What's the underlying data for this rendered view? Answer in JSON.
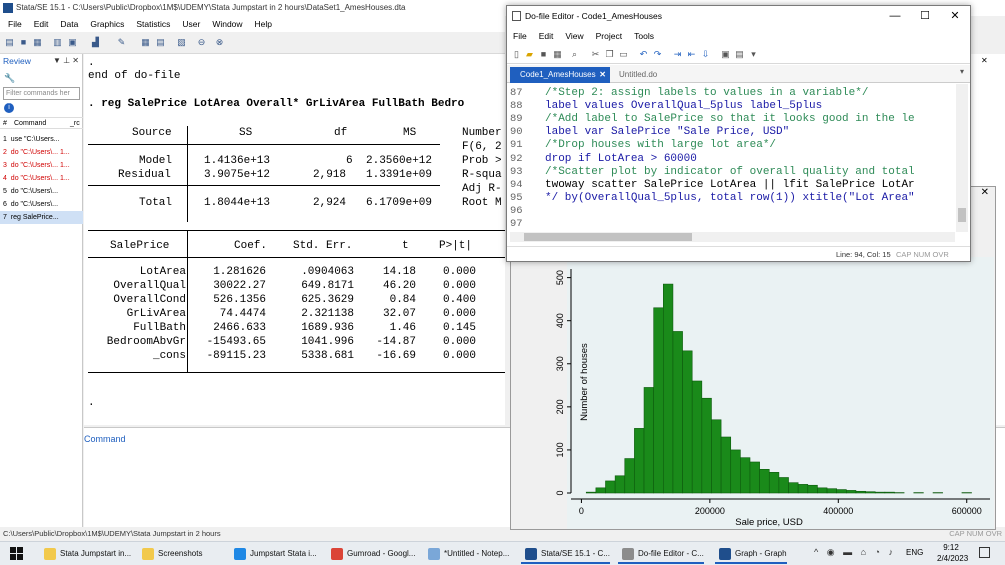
{
  "stata": {
    "title": "Stata/SE 15.1 - C:\\Users\\Public\\Dropbox\\1M$\\UDEMY\\Stata Jumpstart in 2 hours\\DataSet1_AmesHouses.dta",
    "menu": [
      "File",
      "Edit",
      "Data",
      "Graphics",
      "Statistics",
      "User",
      "Window",
      "Help"
    ],
    "review": {
      "label": "Review",
      "filter_placeholder": "Filter commands her",
      "col_num": "#",
      "col_command": "Command",
      "col_rc": "_rc",
      "items": [
        {
          "num": "1",
          "text": "use \"C:\\Users...",
          "error": false
        },
        {
          "num": "2",
          "text": "do \"C:\\Users\\... 1...",
          "error": true
        },
        {
          "num": "3",
          "text": "do \"C:\\Users\\... 1...",
          "error": true
        },
        {
          "num": "4",
          "text": "do \"C:\\Users\\... 1...",
          "error": true
        },
        {
          "num": "5",
          "text": "do \"C:\\Users\\...",
          "error": false
        },
        {
          "num": "6",
          "text": "do \"C:\\Users\\...",
          "error": false
        },
        {
          "num": "7",
          "text": "reg SalePrice...",
          "error": false
        }
      ]
    },
    "results": {
      "dot1": ".",
      "end_line": "end of do-file",
      "cmd": ". reg SalePrice LotArea Overall* GrLivArea FullBath Bedro",
      "anova_header": {
        "source": "Source",
        "ss": "SS",
        "df": "df",
        "ms": "MS"
      },
      "anova_rows": [
        {
          "source": "Model",
          "ss": "1.4136e+13",
          "df": "6",
          "ms": "2.3560e+12"
        },
        {
          "source": "Residual",
          "ss": "3.9075e+12",
          "df": "2,918",
          "ms": "1.3391e+09"
        },
        {
          "source": "Total",
          "ss": "1.8044e+13",
          "df": "2,924",
          "ms": "6.1709e+09"
        }
      ],
      "stats_labels": [
        "Number",
        "F(6, 2",
        "Prob >",
        "R-squa",
        "Adj R-",
        "Root M"
      ],
      "coef_header": {
        "var": "SalePrice",
        "coef": "Coef.",
        "se": "Std. Err.",
        "t": "t",
        "p": "P>|t|"
      },
      "coef_rows": [
        {
          "var": "LotArea",
          "coef": "1.281626",
          "se": ".0904063",
          "t": "14.18",
          "p": "0.000"
        },
        {
          "var": "OverallQual",
          "coef": "30022.27",
          "se": "649.8171",
          "t": "46.20",
          "p": "0.000"
        },
        {
          "var": "OverallCond",
          "coef": "526.1356",
          "se": "625.3629",
          "t": "0.84",
          "p": "0.400"
        },
        {
          "var": "GrLivArea",
          "coef": "74.4474",
          "se": "2.321138",
          "t": "32.07",
          "p": "0.000"
        },
        {
          "var": "FullBath",
          "coef": "2466.633",
          "se": "1689.936",
          "t": "1.46",
          "p": "0.145"
        },
        {
          "var": "BedroomAbvGr",
          "coef": "-15493.65",
          "se": "1041.996",
          "t": "-14.87",
          "p": "0.000"
        },
        {
          "var": "_cons",
          "coef": "-89115.23",
          "se": "5338.681",
          "t": "-16.69",
          "p": "0.000"
        }
      ],
      "dot2": "."
    },
    "command_label": "Command",
    "status_path": "C:\\Users\\Public\\Dropbox\\1M$\\UDEMY\\Stata Jumpstart in 2 hours",
    "status_right": "CAP   NUM   OVR"
  },
  "dofile": {
    "title": "Do-file Editor - Code1_AmesHouses",
    "menu": [
      "File",
      "Edit",
      "View",
      "Project",
      "Tools"
    ],
    "tab_active": "Code1_AmesHouses",
    "tab_inactive": "Untitled.do",
    "lines": [
      {
        "n": "87",
        "cls": "c-cmt",
        "text": "/*Step 2: assign labels to values in a variable*/"
      },
      {
        "n": "88",
        "cls": "c-kw",
        "text": "label values OverallQual_5plus label_5plus"
      },
      {
        "n": "89",
        "cls": "c-cmt",
        "text": "/*Add label to SalePrice so that it looks good in the le"
      },
      {
        "n": "90",
        "cls": "c-kw",
        "text": "label var SalePrice \"Sale Price, USD\""
      },
      {
        "n": "91",
        "cls": "c-cmt",
        "text": "/*Drop houses with large lot area*/"
      },
      {
        "n": "92",
        "cls": "c-kw",
        "text": "drop if LotArea > 60000"
      },
      {
        "n": "93",
        "cls": "c-cmt",
        "text": "/*Scatter plot by indicator of overall quality and total"
      },
      {
        "n": "94",
        "cls": "c-pl",
        "text": "twoway scatter SalePrice LotArea || lfit SalePrice LotAr"
      },
      {
        "n": "95",
        "cls": "c-kw",
        "text": "*/ by(OverallQual_5plus, total row(1)) xtitle(\"Lot Area\""
      },
      {
        "n": "96",
        "cls": "c-pl",
        "text": ""
      },
      {
        "n": "97",
        "cls": "c-pl",
        "text": ""
      }
    ],
    "status": "Line: 94, Col: 15",
    "status_right": "CAP   NUM   OVR"
  },
  "graph": {
    "chart_data": {
      "type": "bar",
      "title": "",
      "xlabel": "Sale price, USD",
      "ylabel": "Number of houses",
      "xlim": [
        -10000,
        630000
      ],
      "ylim": [
        0,
        520
      ],
      "xticks": [
        0,
        200000,
        400000,
        600000
      ],
      "yticks": [
        0,
        100,
        200,
        300,
        400,
        500
      ],
      "bin_width": 15000,
      "bins": [
        {
          "x": 15000,
          "count": 2
        },
        {
          "x": 30000,
          "count": 12
        },
        {
          "x": 45000,
          "count": 28
        },
        {
          "x": 60000,
          "count": 40
        },
        {
          "x": 75000,
          "count": 80
        },
        {
          "x": 90000,
          "count": 150
        },
        {
          "x": 105000,
          "count": 245
        },
        {
          "x": 120000,
          "count": 430
        },
        {
          "x": 135000,
          "count": 485
        },
        {
          "x": 150000,
          "count": 375
        },
        {
          "x": 165000,
          "count": 330
        },
        {
          "x": 180000,
          "count": 260
        },
        {
          "x": 195000,
          "count": 220
        },
        {
          "x": 210000,
          "count": 170
        },
        {
          "x": 225000,
          "count": 130
        },
        {
          "x": 240000,
          "count": 100
        },
        {
          "x": 255000,
          "count": 82
        },
        {
          "x": 270000,
          "count": 72
        },
        {
          "x": 285000,
          "count": 55
        },
        {
          "x": 300000,
          "count": 48
        },
        {
          "x": 315000,
          "count": 36
        },
        {
          "x": 330000,
          "count": 24
        },
        {
          "x": 345000,
          "count": 20
        },
        {
          "x": 360000,
          "count": 18
        },
        {
          "x": 375000,
          "count": 12
        },
        {
          "x": 390000,
          "count": 10
        },
        {
          "x": 405000,
          "count": 8
        },
        {
          "x": 420000,
          "count": 6
        },
        {
          "x": 435000,
          "count": 4
        },
        {
          "x": 450000,
          "count": 3
        },
        {
          "x": 465000,
          "count": 2
        },
        {
          "x": 480000,
          "count": 2
        },
        {
          "x": 495000,
          "count": 1
        },
        {
          "x": 525000,
          "count": 1
        },
        {
          "x": 555000,
          "count": 1
        },
        {
          "x": 600000,
          "count": 1
        }
      ],
      "bar_color": "#1a8a1a"
    }
  },
  "taskbar": {
    "items": [
      {
        "label": "Stata Jumpstart in...",
        "color": "#f2c94c",
        "active": false
      },
      {
        "label": "Screenshots",
        "color": "#f2c94c",
        "active": false
      },
      {
        "label": "Jumpstart Stata i...",
        "color": "#1e88e5",
        "active": false
      },
      {
        "label": "Gumroad - Googl...",
        "color": "#db4437",
        "active": false
      },
      {
        "label": "*Untitled - Notep...",
        "color": "#7aa7d8",
        "active": false
      },
      {
        "label": "Stata/SE 15.1 - C...",
        "color": "#1f4e8c",
        "active": true
      },
      {
        "label": "Do-file Editor - C...",
        "color": "#8c8c8c",
        "active": true
      },
      {
        "label": "Graph - Graph",
        "color": "#1f4e8c",
        "active": true
      }
    ],
    "lang": "ENG",
    "time": "9:12",
    "date": "2/4/2023"
  }
}
